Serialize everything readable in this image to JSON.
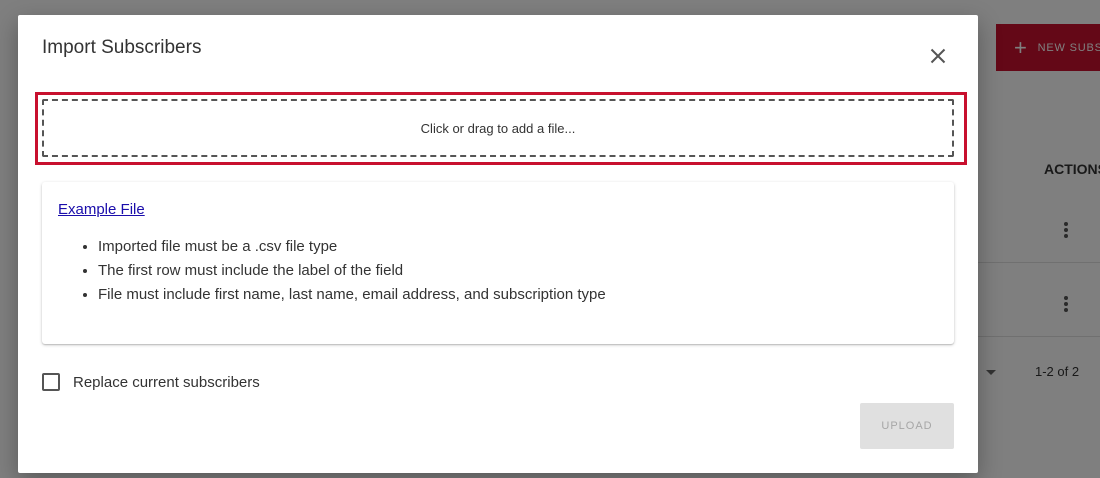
{
  "background": {
    "new_button_label": "NEW SUBSCRIBER",
    "actions_header": "ACTIONS",
    "pager_text": "1-2 of 2"
  },
  "dialog": {
    "title": "Import Subscribers",
    "dropzone_text": "Click or drag to add a file...",
    "example_link": "Example File",
    "rules": [
      "Imported file must be a .csv file type",
      "The first row must include the label of the field",
      "File must include first name, last name, email address, and subscription type"
    ],
    "replace_checkbox": {
      "label": "Replace current subscribers",
      "checked": false
    },
    "upload_label": "UPLOAD",
    "upload_disabled": true
  },
  "colors": {
    "accent": "#c8102e",
    "link": "#1a0dab",
    "disabled_bg": "#e0e0e0",
    "disabled_text": "#a6a6a6"
  }
}
